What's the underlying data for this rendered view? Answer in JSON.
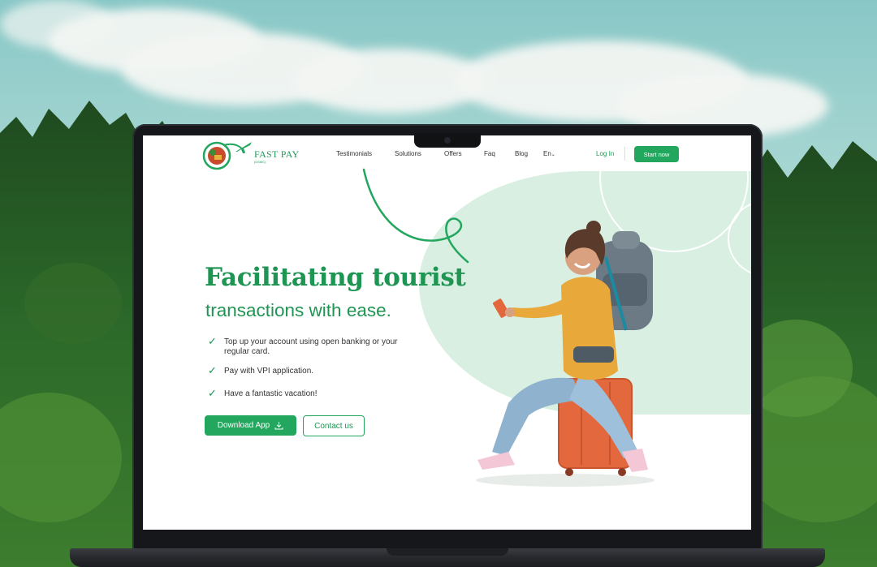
{
  "brand": {
    "name": "FAST PAY",
    "tagline": "(DSMC)"
  },
  "nav": {
    "links": [
      "Testimonials",
      "Solutions",
      "Offers",
      "Faq",
      "Blog"
    ],
    "language": "En",
    "login": "Log In",
    "start": "Start now"
  },
  "hero": {
    "title": "Facilitating tourist",
    "subtitle": "transactions with ease.",
    "bullets": [
      "Top up your account using open banking or your regular card.",
      "Pay with VPI application.",
      "Have a fantastic vacation!"
    ],
    "download_label": "Download App",
    "contact_label": "Contact us"
  },
  "colors": {
    "accent": "#23a65d",
    "blob": "#d8efe2",
    "jacket": "#e8a93a",
    "suitcase": "#e3683e",
    "backpack": "#6b7a85",
    "jeans": "#8fb3cf"
  },
  "icons": [
    "check-icon",
    "download-icon",
    "chevron-down-icon",
    "airplane-icon"
  ]
}
